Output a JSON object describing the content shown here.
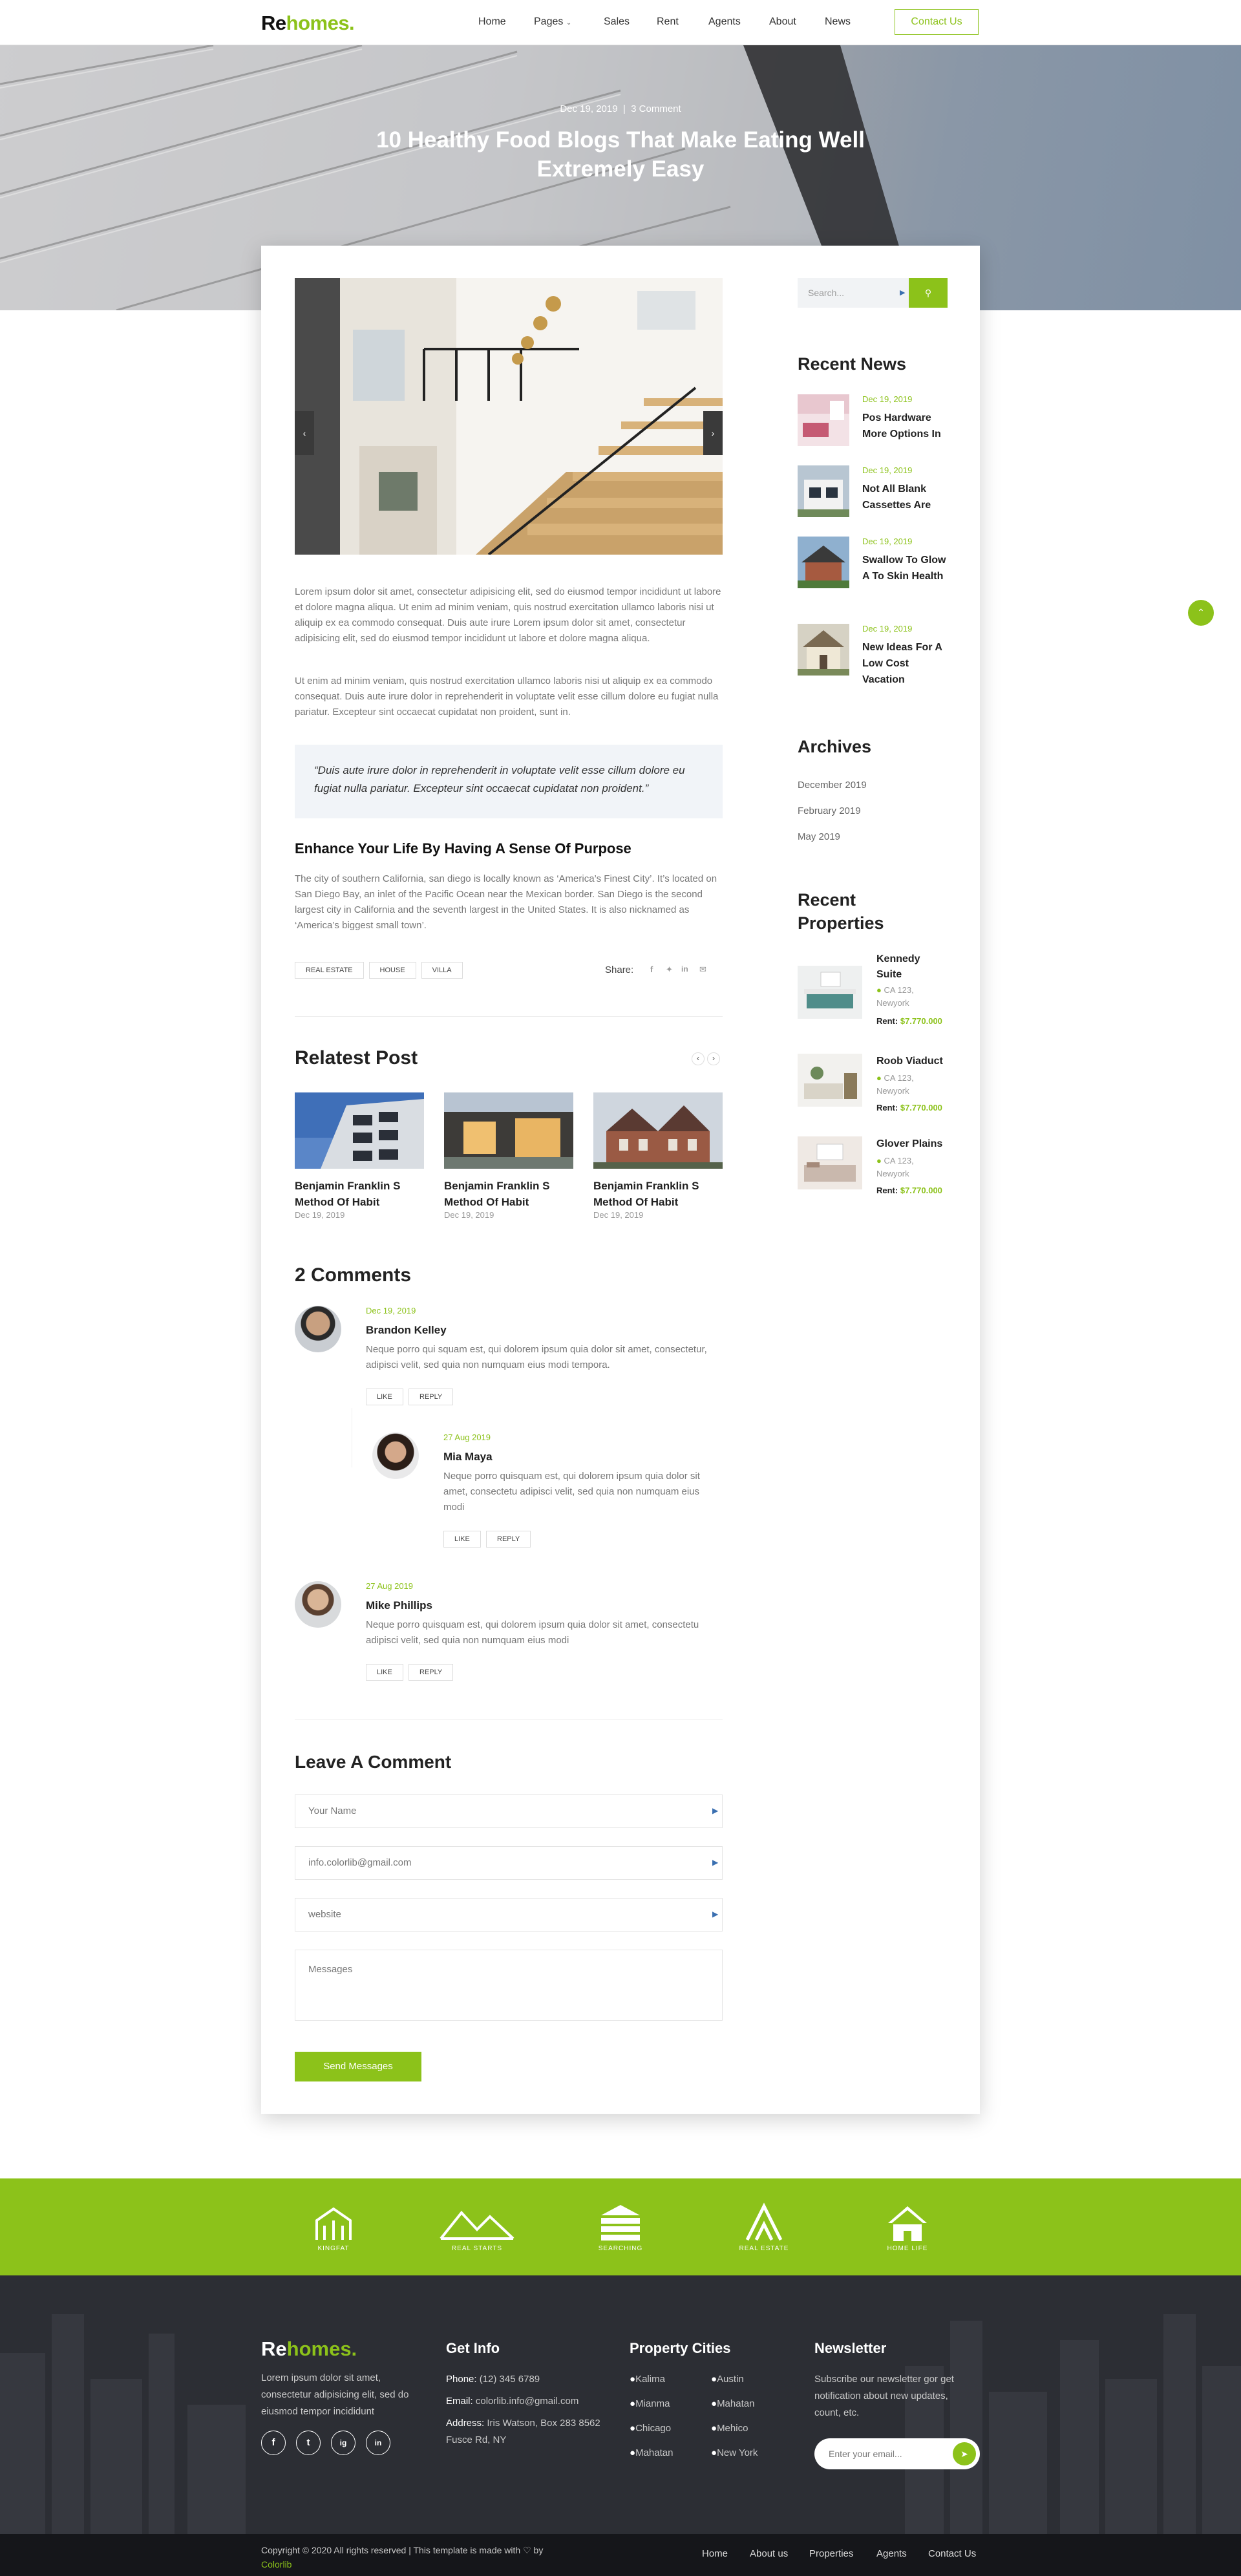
{
  "header": {
    "logo_re": "Re",
    "logo_homes": "homes.",
    "nav": [
      "Home",
      "Pages",
      "Sales",
      "Rent",
      "Agents",
      "About",
      "News"
    ],
    "contact_button": "Contact Us"
  },
  "hero": {
    "date": "Dec 19, 2019",
    "comments": "3 Comment",
    "title": "10 Healthy Food Blogs That Make Eating Well Extremely Easy"
  },
  "post": {
    "paragraph1": "Lorem ipsum dolor sit amet, consectetur adipisicing elit, sed do eiusmod tempor incididunt ut labore et dolore magna aliqua. Ut enim ad minim veniam, quis nostrud exercitation ullamco laboris nisi ut aliquip ex ea commodo consequat. Duis aute irure Lorem ipsum dolor sit amet, consectetur adipisicing elit, sed do eiusmod tempor incididunt ut labore et dolore magna aliqua.",
    "paragraph2": "Ut enim ad minim veniam, quis nostrud exercitation ullamco laboris nisi ut aliquip ex ea commodo consequat. Duis aute irure dolor in reprehenderit in voluptate velit esse cillum dolore eu fugiat nulla pariatur. Excepteur sint occaecat cupidatat non proident, sunt in.",
    "quote": "“Duis aute irure dolor in reprehenderit in voluptate velit esse cillum dolore eu fugiat nulla pariatur. Excepteur sint occaecat cupidatat non proident.”",
    "subheading": "Enhance Your Life By Having A Sense Of Purpose",
    "paragraph3": "The city of southern California, san diego is locally known as ‘America’s Finest City’. It’s located on San Diego Bay, an inlet of the Pacific Ocean near the Mexican border. San Diego is the second largest city in California and the seventh largest in the United States. It is also nicknamed as ‘America’s biggest small town’.",
    "tags": [
      "REAL ESTATE",
      "HOUSE",
      "VILLA"
    ],
    "share_label": "Share:",
    "share_icons": [
      "facebook-icon",
      "twitter-icon",
      "linkedin-icon",
      "email-icon"
    ]
  },
  "related": {
    "title": "Relatest Post",
    "posts": [
      {
        "title": "Benjamin Franklin S Method Of Habit",
        "date": "Dec 19, 2019"
      },
      {
        "title": "Benjamin Franklin S Method Of Habit",
        "date": "Dec 19, 2019"
      },
      {
        "title": "Benjamin Franklin S Method Of Habit",
        "date": "Dec 19, 2019"
      }
    ]
  },
  "comments": {
    "title": "2 Comments",
    "like": "LIKE",
    "reply": "REPLY",
    "items": [
      {
        "date": "Dec 19, 2019",
        "name": "Brandon Kelley",
        "text": "Neque porro qui squam est, qui dolorem ipsum quia dolor sit amet, consectetur, adipisci velit, sed quia non numquam eius modi tempora."
      },
      {
        "date": "27 Aug 2019",
        "name": "Mia Maya",
        "text": "Neque porro quisquam est, qui dolorem ipsum quia dolor sit amet, consectetu adipisci velit, sed quia non numquam eius modi"
      },
      {
        "date": "27 Aug 2019",
        "name": "Mike Phillips",
        "text": "Neque porro quisquam est, qui dolorem ipsum quia dolor sit amet, consectetu adipisci velit, sed quia non numquam eius modi"
      }
    ]
  },
  "leave_comment": {
    "title": "Leave A Comment",
    "name_placeholder": "Your Name",
    "email_placeholder": "info.colorlib@gmail.com",
    "website_placeholder": "website",
    "messages_placeholder": "Messages",
    "submit": "Send Messages"
  },
  "sidebar": {
    "search_placeholder": "Search...",
    "recent_news_title": "Recent News",
    "news": [
      {
        "date": "Dec 19, 2019",
        "title": "Pos Hardware More Options In"
      },
      {
        "date": "Dec 19, 2019",
        "title": "Not All Blank Cassettes Are"
      },
      {
        "date": "Dec 19, 2019",
        "title": "Swallow To Glow A To Skin Health"
      },
      {
        "date": "Dec 19, 2019",
        "title": "New Ideas For A Low Cost Vacation"
      }
    ],
    "archives_title": "Archives",
    "archives": [
      "December 2019",
      "February 2019",
      "May 2019"
    ],
    "recent_properties_title": "Recent Properties",
    "properties": [
      {
        "name": "Kennedy Suite",
        "location": "CA 123, Newyork",
        "rent_label": "Rent:",
        "price": "$7.770.000"
      },
      {
        "name": "Roob Viaduct",
        "location": "CA 123, Newyork",
        "rent_label": "Rent:",
        "price": "$7.770.000"
      },
      {
        "name": "Glover Plains",
        "location": "CA 123, Newyork",
        "rent_label": "Rent:",
        "price": "$7.770.000"
      }
    ]
  },
  "partners": [
    "KINGFAT",
    "REAL STARTS",
    "SEARCHING",
    "REAL ESTATE",
    "HOME LIFE"
  ],
  "footer": {
    "about": "Lorem ipsum dolor sit amet, consectetur adipisicing elit, sed do eiusmod tempor incididunt",
    "social": [
      "f",
      "t",
      "ig",
      "in"
    ],
    "get_info_title": "Get Info",
    "phone_label": "Phone:",
    "phone": "(12) 345 6789",
    "email_label": "Email:",
    "email": "colorlib.info@gmail.com",
    "address_label": "Address:",
    "address": "Iris Watson, Box 283 8562 Fusce Rd, NY",
    "cities_title": "Property Cities",
    "cities_col1": [
      "Kalima",
      "Mianma",
      "Chicago",
      "Mahatan"
    ],
    "cities_col2": [
      "Austin",
      "Mahatan",
      "Mehico",
      "New York"
    ],
    "newsletter_title": "Newsletter",
    "newsletter_text": "Subscribe our newsletter gor get notification about new updates, count, etc.",
    "newsletter_placeholder": "Enter your email...",
    "copyright": "Copyright © 2020 All rights reserved | This template is made with ♡ by",
    "copyright_link": "Colorlib",
    "bottom_links": [
      "Home",
      "About us",
      "Properties",
      "Agents",
      "Contact Us"
    ]
  },
  "colors": {
    "accent": "#8cc21a",
    "footer_bg": "#2c2e34",
    "bottom_bar": "#15161a"
  }
}
